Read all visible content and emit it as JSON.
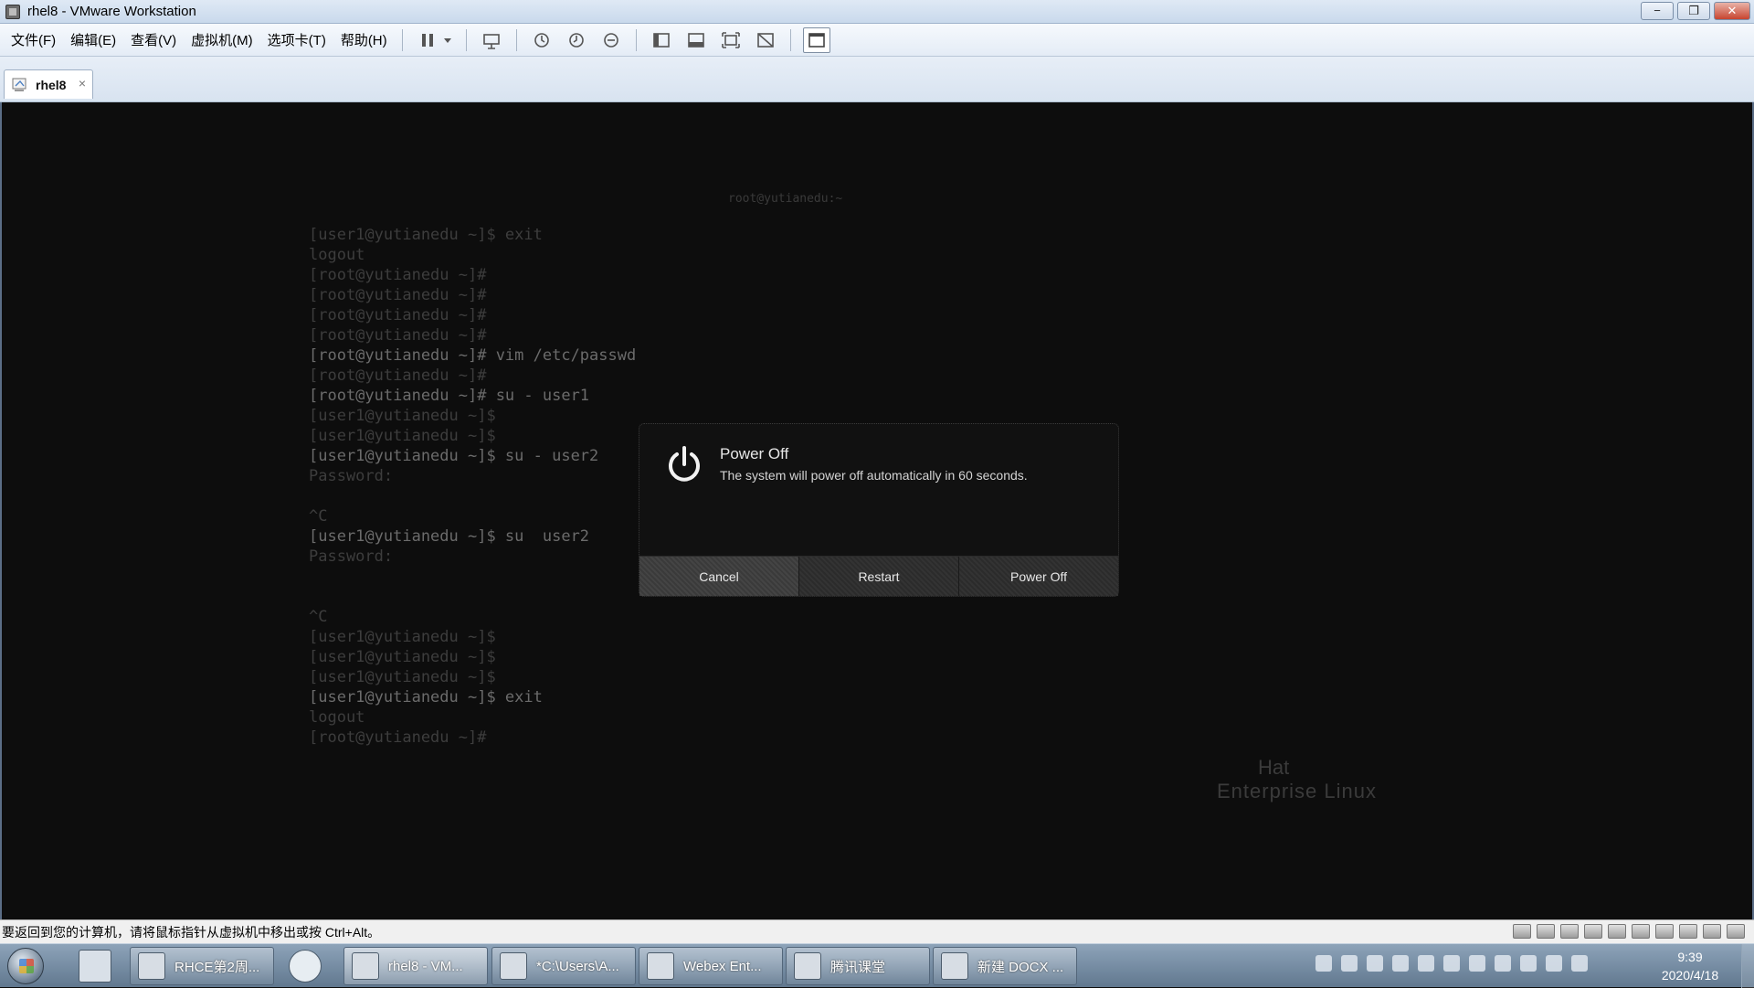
{
  "window": {
    "title": "rhel8 - VMware Workstation",
    "controls": [
      "−",
      "❐",
      "✕"
    ]
  },
  "menu": [
    "文件(F)",
    "编辑(E)",
    "查看(V)",
    "虚拟机(M)",
    "选项卡(T)",
    "帮助(H)"
  ],
  "tab": {
    "label": "rhel8",
    "close": "×"
  },
  "terminal": {
    "header": "root@yutianedu:~",
    "lines": [
      "[user1@yutianedu ~]$ exit",
      "logout",
      "[root@yutianedu ~]#",
      "[root@yutianedu ~]#",
      "[root@yutianedu ~]#",
      "[root@yutianedu ~]#",
      "[root@yutianedu ~]# vim /etc/passwd",
      "[root@yutianedu ~]#",
      "[root@yutianedu ~]# su - user1",
      "[user1@yutianedu ~]$",
      "[user1@yutianedu ~]$",
      "[user1@yutianedu ~]$ su - user2",
      "Password:",
      "",
      "^C",
      "[user1@yutianedu ~]$ su  user2",
      "Password:",
      "",
      "",
      "^C",
      "[user1@yutianedu ~]$",
      "[user1@yutianedu ~]$",
      "[user1@yutianedu ~]$",
      "[user1@yutianedu ~]$ exit",
      "logout",
      "[root@yutianedu ~]#"
    ]
  },
  "brand": {
    "line1": "Hat",
    "line2": "Enterprise Linux"
  },
  "dialog": {
    "title": "Power Off",
    "message": "The system will power off automatically in 60 seconds.",
    "buttons": {
      "cancel": "Cancel",
      "restart": "Restart",
      "poweroff": "Power Off"
    }
  },
  "statusbar": {
    "text": "要返回到您的计算机，请将鼠标指针从虚拟机中移出或按 Ctrl+Alt。"
  },
  "taskbar": {
    "tasks": [
      {
        "label": "RHCE第2周...",
        "active": false
      },
      {
        "label": "rhel8 - VM...",
        "active": true
      },
      {
        "label": "*C:\\Users\\A...",
        "active": false
      },
      {
        "label": "Webex Ent...",
        "active": false
      },
      {
        "label": "腾讯课堂",
        "active": false
      },
      {
        "label": "新建 DOCX ...",
        "active": false
      }
    ],
    "clock": {
      "time": "9:39",
      "date": "2020/4/18"
    }
  }
}
